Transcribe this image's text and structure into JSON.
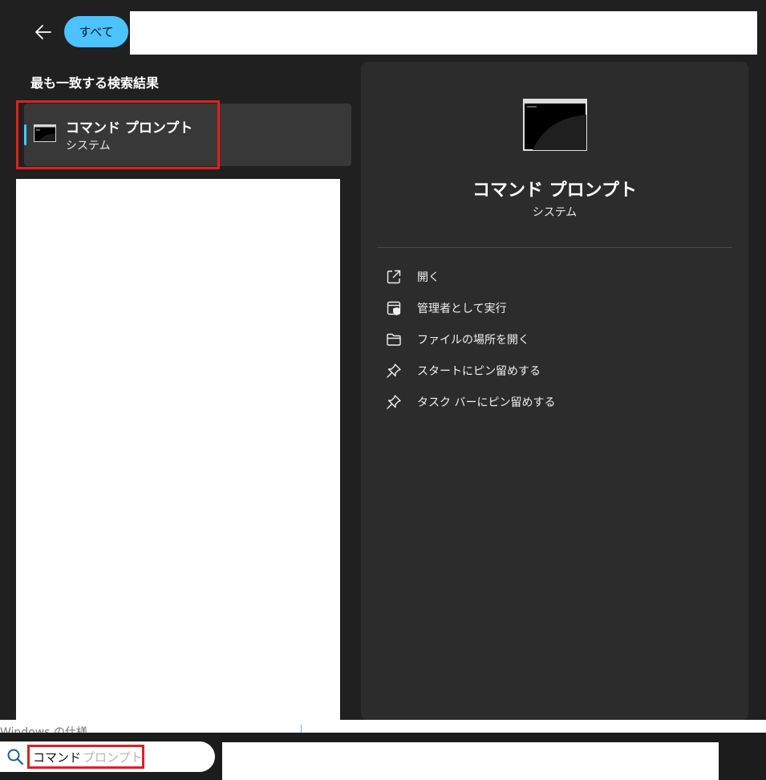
{
  "header": {
    "back_icon": "arrow-left-icon",
    "filter_chip": "すべて"
  },
  "results": {
    "section_heading": "最も一致する検索結果",
    "best_match": {
      "title": "コマンド プロンプト",
      "subtitle": "システム",
      "icon": "command-prompt-icon"
    }
  },
  "detail": {
    "title": "コマンド プロンプト",
    "subtitle": "システム",
    "actions": [
      {
        "label": "開く",
        "icon": "open-external-icon"
      },
      {
        "label": "管理者として実行",
        "icon": "run-as-admin-icon"
      },
      {
        "label": "ファイルの場所を開く",
        "icon": "folder-icon"
      },
      {
        "label": "スタートにピン留めする",
        "icon": "pin-icon"
      },
      {
        "label": "タスク バーにピン留めする",
        "icon": "pin-icon"
      }
    ]
  },
  "background_fragment": "Windows の仕様",
  "taskbar": {
    "search_icon": "search-icon",
    "query": "コマンド",
    "suggestion": "プロンプト"
  },
  "colors": {
    "accent": "#4cc2ff",
    "highlight_box": "#e02020",
    "panel": "#2c2c2c",
    "background": "#202020"
  }
}
